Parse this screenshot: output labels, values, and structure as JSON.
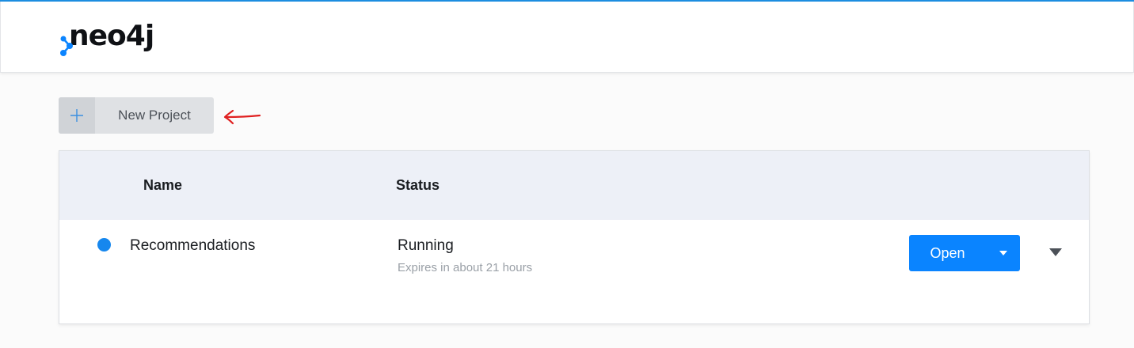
{
  "app": {
    "logo_text": "neo4j"
  },
  "toolbar": {
    "new_project_label": "New Project"
  },
  "table": {
    "columns": [
      "Name",
      "Status"
    ],
    "rows": [
      {
        "name": "Recommendations",
        "status": "Running",
        "status_detail": "Expires in about 21 hours",
        "open_label": "Open"
      }
    ]
  },
  "colors": {
    "accent": "#0a84ff",
    "status_running": "#1687ee",
    "annotation": "#e02020"
  },
  "icons": [
    "neo4j-logo-icon",
    "plus-icon",
    "chevron-down-icon",
    "caret-down-icon",
    "arrow-left-icon"
  ]
}
